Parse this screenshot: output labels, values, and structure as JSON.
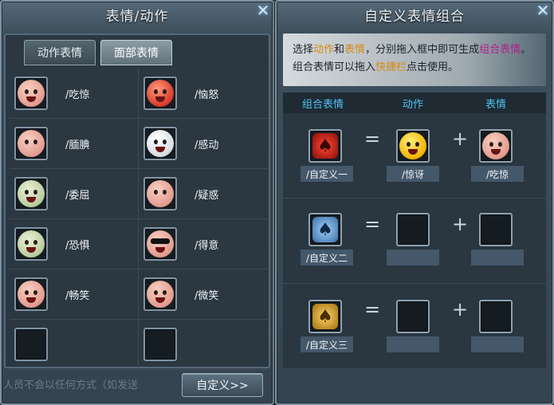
{
  "left_panel": {
    "title": "表情/动作",
    "tabs": [
      {
        "label": "动作表情",
        "active": false
      },
      {
        "label": "面部表情",
        "active": true
      }
    ],
    "emotes": [
      {
        "label": "/吃惊",
        "icon": "shocked-face-icon"
      },
      {
        "label": "/恼怒",
        "icon": "angry-face-icon"
      },
      {
        "label": "/腼腆",
        "icon": "shy-face-icon"
      },
      {
        "label": "/感动",
        "icon": "touched-face-icon"
      },
      {
        "label": "/委屈",
        "icon": "wronged-face-icon"
      },
      {
        "label": "/疑惑",
        "icon": "puzzled-face-icon"
      },
      {
        "label": "/恐惧",
        "icon": "fear-face-icon"
      },
      {
        "label": "/得意",
        "icon": "smug-face-icon"
      },
      {
        "label": "/畅笑",
        "icon": "laugh-face-icon"
      },
      {
        "label": "/微笑",
        "icon": "smile-face-icon"
      },
      {
        "label": "",
        "icon": ""
      },
      {
        "label": "",
        "icon": ""
      }
    ],
    "custom_button": "自定义>>",
    "background_chat": "人员不会以任何方式（如发送"
  },
  "right_panel": {
    "title": "自定义表情组合",
    "info_line1_parts": [
      "选择",
      "动作",
      "和",
      "表情",
      "，分别拖入框中即可生成",
      "组合表情",
      "。"
    ],
    "info_line2_parts": [
      "组合表情可以拖入",
      "快捷栏",
      "点击使用。"
    ],
    "headers": {
      "combo": "组合表情",
      "action": "动作",
      "emote": "表情"
    },
    "rows": [
      {
        "combo_label": "/自定义一",
        "action_label": "/惊讶",
        "emote_label": "/吃惊",
        "combo_icon": "red-custom-icon",
        "action_icon": "surprised-action-icon",
        "emote_icon": "shocked-face-icon"
      },
      {
        "combo_label": "/自定义二",
        "action_label": "",
        "emote_label": "",
        "combo_icon": "blue-custom-icon"
      },
      {
        "combo_label": "/自定义三",
        "action_label": "",
        "emote_label": "",
        "combo_icon": "gold-custom-icon"
      }
    ],
    "operators": {
      "equals": "=",
      "plus": "+"
    }
  },
  "close_glyph": "✕"
}
